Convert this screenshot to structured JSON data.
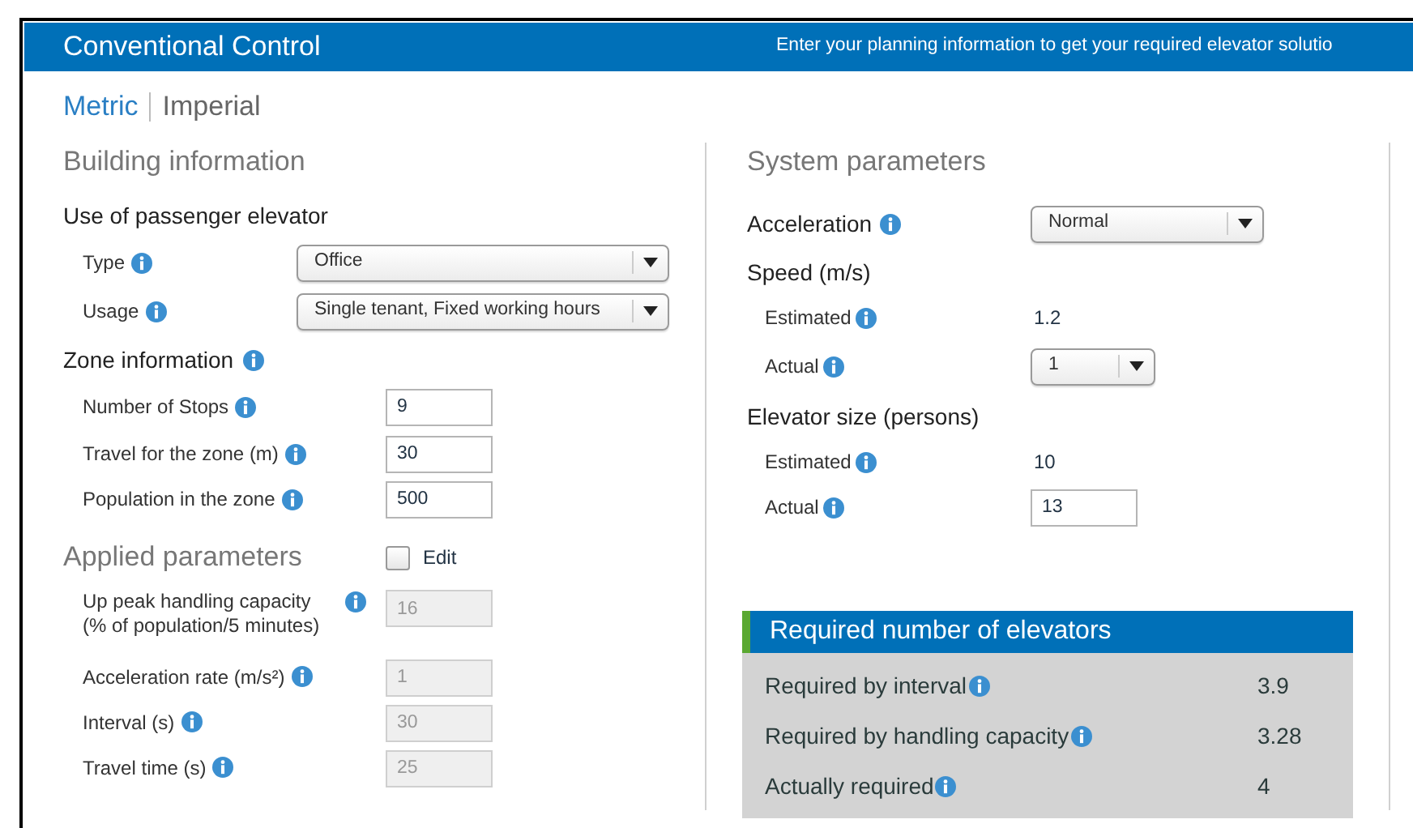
{
  "header": {
    "title": "Conventional Control",
    "tagline": "Enter your planning information to get your required elevator solutio"
  },
  "units": [
    {
      "label": "Metric",
      "selected": true
    },
    {
      "label": "Imperial",
      "selected": false
    }
  ],
  "building": {
    "title": "Building information",
    "groups": [
      {
        "title": "Use of passenger elevator",
        "info": false,
        "rows": [
          {
            "label": "Type",
            "info": true,
            "kind": "select",
            "value": "Office"
          },
          {
            "label": "Usage",
            "info": true,
            "kind": "select",
            "value": "Single tenant, Fixed working hours"
          }
        ]
      },
      {
        "title": "Zone information",
        "info": true,
        "rows": [
          {
            "label": "Number of Stops",
            "info": true,
            "kind": "input",
            "value": "9"
          },
          {
            "label": "Travel for the zone (m)",
            "info": true,
            "kind": "input",
            "value": "30"
          },
          {
            "label": "Population in the zone",
            "info": true,
            "kind": "input",
            "value": "500"
          }
        ]
      }
    ]
  },
  "applied": {
    "title": "Applied parameters",
    "edit": {
      "label": "Edit",
      "checked": false
    },
    "rows": [
      {
        "label": "Up peak handling capacity",
        "sublabel": "(% of population/5 minutes)",
        "info": true,
        "value": "16",
        "disabled": true
      },
      {
        "label": "Acceleration rate (m/s²)",
        "info": true,
        "value": "1",
        "disabled": true
      },
      {
        "label": "Interval (s)",
        "info": true,
        "value": "30",
        "disabled": true
      },
      {
        "label": "Travel time (s)",
        "info": true,
        "value": "25",
        "disabled": true
      }
    ]
  },
  "system": {
    "title": "System parameters",
    "groups": [
      {
        "title": "Acceleration",
        "info": true,
        "kind": "select",
        "value": "Normal"
      },
      {
        "title": "Speed (m/s)",
        "info": false,
        "rows": [
          {
            "label": "Estimated",
            "info": true,
            "kind": "text",
            "value": "1.2"
          },
          {
            "label": "Actual",
            "info": true,
            "kind": "select",
            "value": "1"
          }
        ]
      },
      {
        "title": "Elevator size (persons)",
        "info": false,
        "rows": [
          {
            "label": "Estimated",
            "info": true,
            "kind": "text",
            "value": "10"
          },
          {
            "label": "Actual",
            "info": true,
            "kind": "input",
            "value": "13"
          }
        ]
      }
    ]
  },
  "result": {
    "title": "Required number of elevators",
    "rows": [
      {
        "label": "Required by interval",
        "info": true,
        "value": "3.9"
      },
      {
        "label": "Required by handling capacity",
        "info": true,
        "value": "3.28"
      },
      {
        "label": "Actually required",
        "info": true,
        "value": "4"
      }
    ]
  }
}
